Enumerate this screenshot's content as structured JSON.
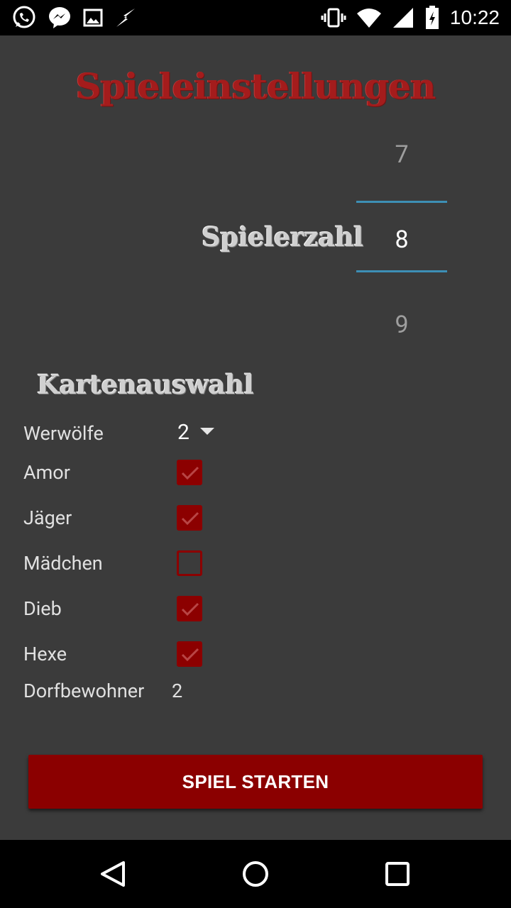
{
  "status_bar": {
    "time": "10:22",
    "left_icons": [
      "whatsapp-icon",
      "messenger-icon",
      "image-icon",
      "flash-icon"
    ],
    "right_icons": [
      "vibrate-icon",
      "wifi-icon",
      "signal-icon",
      "battery-icon"
    ]
  },
  "page": {
    "title": "Spieleinstellungen"
  },
  "player_count": {
    "label": "Spielerzahl",
    "previous": "7",
    "current": "8",
    "next": "9",
    "accent_color": "#3d8fb5"
  },
  "cards": {
    "heading": "Kartenauswahl",
    "werewolves": {
      "label": "Werwölfe",
      "value": "2"
    },
    "roles": [
      {
        "label": "Amor",
        "checked": true
      },
      {
        "label": "Jäger",
        "checked": true
      },
      {
        "label": "Mädchen",
        "checked": false
      },
      {
        "label": "Dieb",
        "checked": true
      },
      {
        "label": "Hexe",
        "checked": true
      }
    ],
    "villagers": {
      "label": "Dorfbewohner",
      "value": "2"
    },
    "checkbox_color": "#8c0000"
  },
  "actions": {
    "start_label": "SPIEL STARTEN",
    "button_color": "#8b0000"
  },
  "nav_bar": {
    "icons": [
      "back-icon",
      "home-icon",
      "recent-apps-icon"
    ]
  },
  "colors": {
    "background": "#3b3b3b",
    "title": "#a41c1c"
  }
}
